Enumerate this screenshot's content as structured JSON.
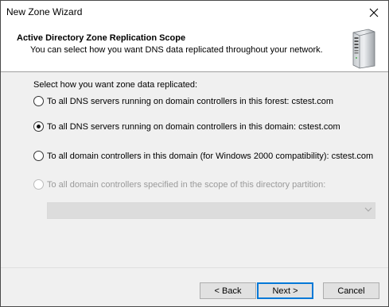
{
  "window": {
    "title": "New Zone Wizard"
  },
  "header": {
    "title": "Active Directory Zone Replication Scope",
    "subtitle": "You can select how you want DNS data replicated throughout your network."
  },
  "body": {
    "prompt": "Select how you want zone data replicated:",
    "options": [
      {
        "label": "To all DNS servers running on domain controllers in this forest: cstest.com",
        "selected": false,
        "enabled": true
      },
      {
        "label": "To all DNS servers running on domain controllers in this domain: cstest.com",
        "selected": true,
        "enabled": true
      },
      {
        "label": "To all domain controllers in this domain (for Windows 2000 compatibility): cstest.com",
        "selected": false,
        "enabled": true
      },
      {
        "label": "To all domain controllers specified in the scope of this directory partition:",
        "selected": false,
        "enabled": false
      }
    ],
    "partition_value": ""
  },
  "buttons": {
    "back": "< Back",
    "next": "Next >",
    "cancel": "Cancel"
  },
  "icons": {
    "close": "close-icon",
    "server": "server-icon",
    "dropdown": "chevron-down-icon"
  },
  "colors": {
    "accent": "#0078d7",
    "dialog_bg": "#f0f0f0"
  }
}
